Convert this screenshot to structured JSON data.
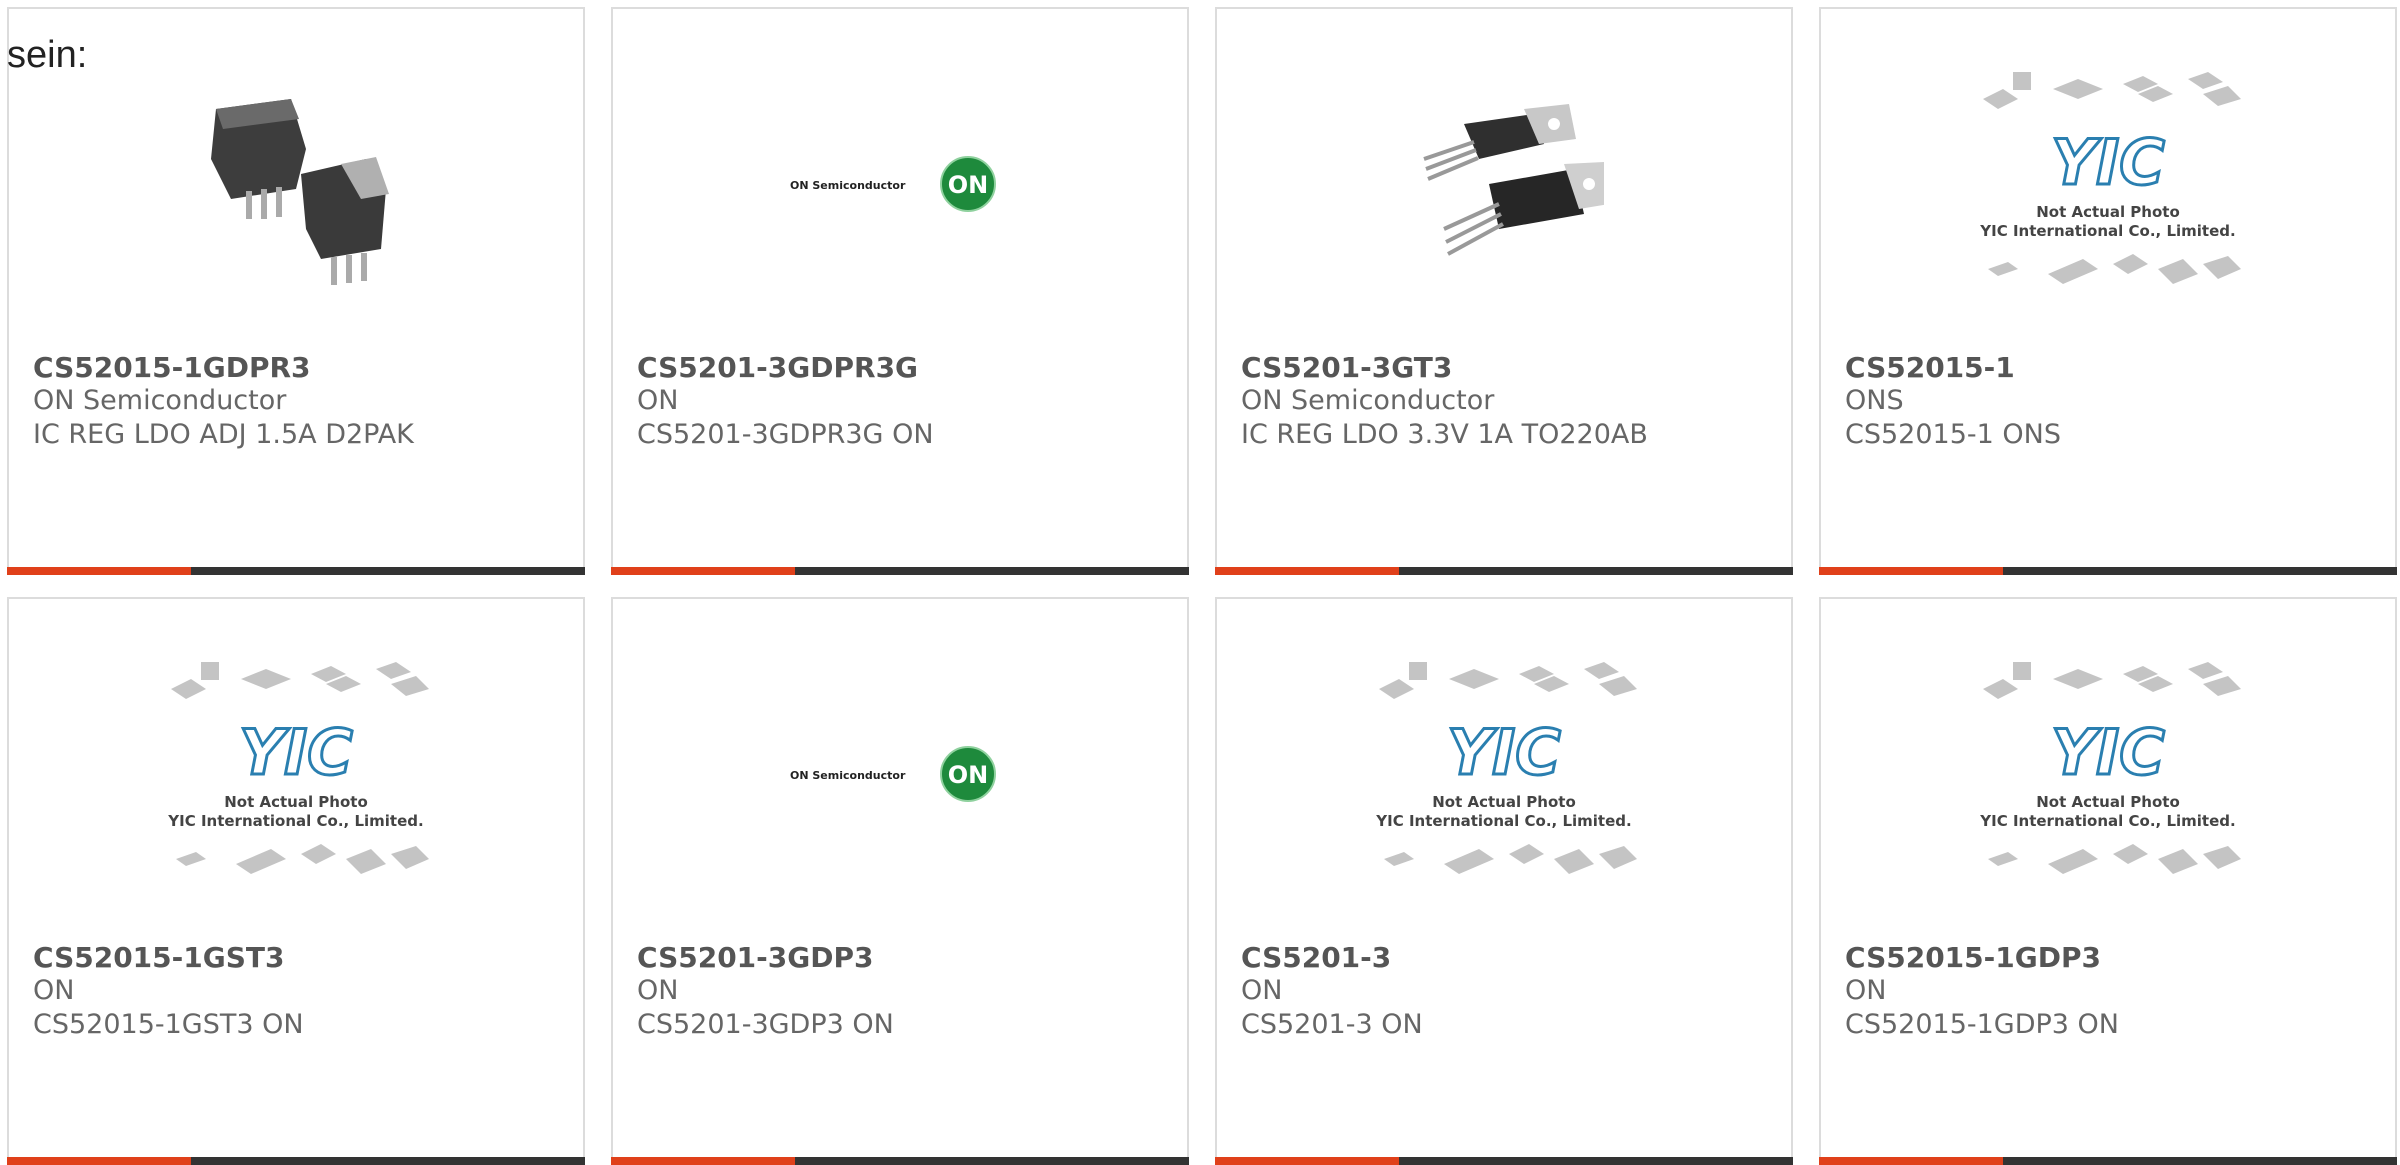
{
  "lead_text": "sein:",
  "products": [
    {
      "part": "CS52015-1GDPR3",
      "manufacturer": "ON Semiconductor",
      "description": "IC REG LDO ADJ 1.5A D2PAK",
      "image": "d2pak-photo"
    },
    {
      "part": "CS5201-3GDPR3G",
      "manufacturer": "ON",
      "description": "CS5201-3GDPR3G ON",
      "image": "on-semi-logo"
    },
    {
      "part": "CS5201-3GT3",
      "manufacturer": "ON Semiconductor",
      "description": "IC REG LDO 3.3V 1A TO220AB",
      "image": "to220-photo"
    },
    {
      "part": "CS52015-1",
      "manufacturer": "ONS",
      "description": "CS52015-1 ONS",
      "image": "yic-placeholder"
    },
    {
      "part": "CS52015-1GST3",
      "manufacturer": "ON",
      "description": "CS52015-1GST3 ON",
      "image": "yic-placeholder"
    },
    {
      "part": "CS5201-3GDP3",
      "manufacturer": "ON",
      "description": "CS5201-3GDP3 ON",
      "image": "on-semi-logo"
    },
    {
      "part": "CS5201-3",
      "manufacturer": "ON",
      "description": "CS5201-3 ON",
      "image": "yic-placeholder"
    },
    {
      "part": "CS52015-1GDP3",
      "manufacturer": "ON",
      "description": "CS52015-1GDP3 ON",
      "image": "yic-placeholder"
    }
  ],
  "image_text": {
    "on_brand": "ON Semiconductor",
    "on_badge": "ON",
    "yic_line1": "Not Actual Photo",
    "yic_line2": "YIC International Co., Limited."
  },
  "colors": {
    "accent": "#e0401a",
    "bar": "#333333",
    "card_border": "#dcdcdc",
    "on_green": "#1e8a3c",
    "yic_blue": "#2a7fb0"
  }
}
